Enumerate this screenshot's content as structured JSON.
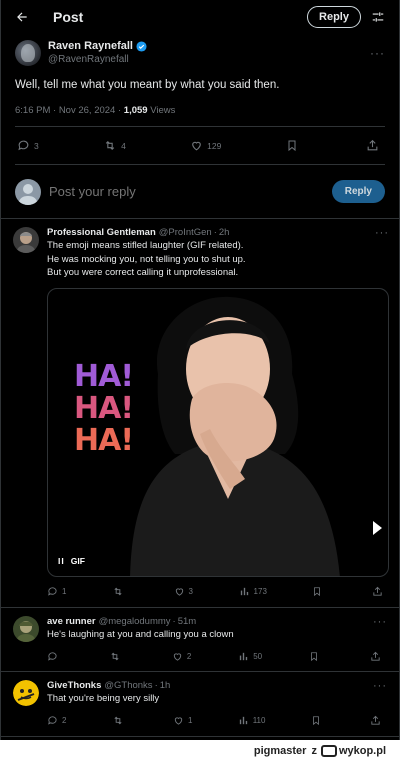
{
  "header": {
    "title": "Post",
    "reply_button": "Reply"
  },
  "post": {
    "author_name": "Raven Raynefall",
    "author_handle": "@RavenRaynefall",
    "text": "Well, tell me what you meant by what you said then.",
    "timestamp": "6:16 PM · Nov 26, 2024 · ",
    "views_count": "1,059",
    "views_label": " Views",
    "stats": {
      "replies": "3",
      "reposts": "4",
      "likes": "129"
    }
  },
  "compose": {
    "placeholder": "Post your reply",
    "button": "Reply"
  },
  "replies": [
    {
      "name": "Professional Gentleman",
      "handle": "@ProIntGen",
      "time": "2h",
      "lines": [
        "The emoji means stifled laughter (GIF related).",
        "He was mocking you, not telling you to shut up.",
        "But you were correct calling it unprofessional."
      ],
      "gif": {
        "line1": "HA!",
        "line2": "HA!",
        "line3": "HA!",
        "badge": "GIF",
        "pause": "II"
      },
      "stats": {
        "replies": "1",
        "reposts": "",
        "likes": "3",
        "views": "173"
      }
    },
    {
      "name": "ave runner",
      "handle": "@megalodummy",
      "time": "51m",
      "text": "He's laughing at you and calling you a clown",
      "stats": {
        "replies": "",
        "reposts": "",
        "likes": "2",
        "views": "50"
      }
    },
    {
      "name": "GiveThonks",
      "handle": "@GThonks",
      "time": "1h",
      "text": "That you're being very silly",
      "stats": {
        "replies": "2",
        "reposts": "",
        "likes": "1",
        "views": "110"
      }
    }
  ],
  "footer": {
    "user": "pigmaster",
    "connector": "z",
    "site": "wykop.pl"
  },
  "colors": {
    "background": "#000000",
    "text": "#e7e9ea",
    "muted": "#71767b",
    "accent": "#1d9bf0",
    "divider": "#2f3336"
  },
  "icons": [
    "back-arrow-icon",
    "tune-icon",
    "verified-badge-icon",
    "more-icon",
    "reply-icon",
    "repost-icon",
    "like-icon",
    "bookmark-icon",
    "share-icon",
    "views-icon",
    "pause-icon"
  ]
}
